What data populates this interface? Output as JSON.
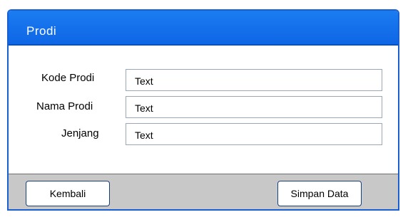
{
  "window": {
    "title": "Prodi"
  },
  "form": {
    "fields": [
      {
        "label": "Kode Prodi",
        "value": "Text"
      },
      {
        "label": "Nama Prodi",
        "value": "Text"
      },
      {
        "label": "Jenjang",
        "value": "Text"
      }
    ]
  },
  "footer": {
    "back_label": "Kembali",
    "save_label": "Simpan Data"
  }
}
